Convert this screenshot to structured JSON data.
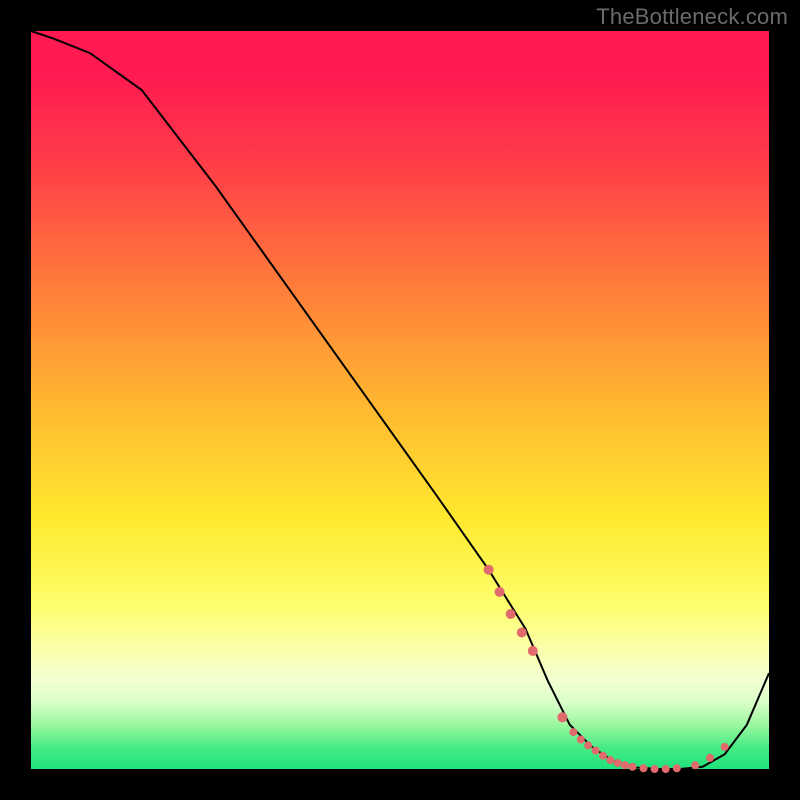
{
  "watermark": "TheBottleneck.com",
  "chart_data": {
    "type": "line",
    "title": "",
    "xlabel": "",
    "ylabel": "",
    "xlim": [
      0,
      100
    ],
    "ylim": [
      0,
      100
    ],
    "series": [
      {
        "name": "curve",
        "x": [
          0,
          3,
          8,
          15,
          25,
          35,
          45,
          55,
          62,
          67,
          70,
          73,
          76,
          79,
          82,
          85,
          88,
          91,
          94,
          97,
          100
        ],
        "values": [
          100,
          99,
          97,
          92,
          79,
          65,
          51,
          37,
          27,
          19,
          12,
          6,
          3,
          1,
          0.2,
          0,
          0,
          0.3,
          2,
          6,
          13
        ]
      }
    ],
    "highlight_points": {
      "comment": "salmon dots along the trough region",
      "x": [
        62,
        63.5,
        65,
        66.5,
        68,
        72,
        73.5,
        74.5,
        75.5,
        76.5,
        77.5,
        78.5,
        79.5,
        80.5,
        81.5,
        83,
        84.5,
        86,
        87.5,
        90,
        92,
        94
      ],
      "values": [
        27,
        24,
        21,
        18.5,
        16,
        7,
        5,
        4,
        3.2,
        2.5,
        1.8,
        1.2,
        0.8,
        0.5,
        0.3,
        0.1,
        0,
        0,
        0.1,
        0.5,
        1.5,
        3
      ]
    },
    "colors": {
      "curve": "#000000",
      "dots": "#e06a6c",
      "gradient_top": "#ff1a52",
      "gradient_mid": "#ffe92e",
      "gradient_bottom": "#1ee27a",
      "frame": "#000000"
    }
  }
}
